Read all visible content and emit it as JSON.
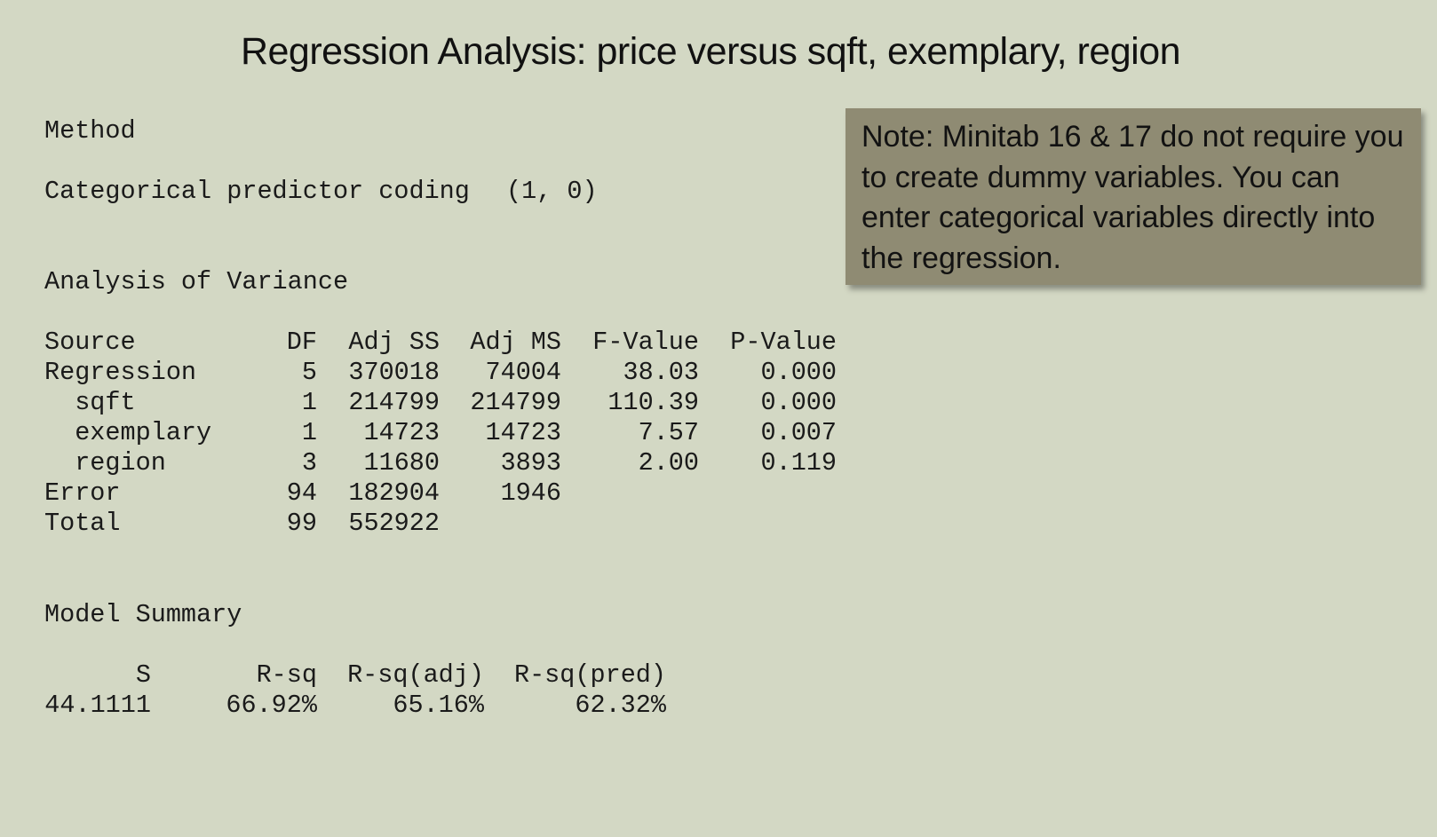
{
  "title": "Regression Analysis: price versus sqft, exemplary, region",
  "method": {
    "heading": "Method",
    "coding_label": "Categorical predictor coding",
    "coding_value": "(1, 0)"
  },
  "anova": {
    "heading": "Analysis of Variance",
    "headers": [
      "Source",
      "DF",
      "Adj SS",
      "Adj MS",
      "F-Value",
      "P-Value"
    ],
    "rows": [
      [
        "Regression",
        "5",
        "370018",
        "74004",
        "38.03",
        "0.000"
      ],
      [
        "  sqft",
        "1",
        "214799",
        "214799",
        "110.39",
        "0.000"
      ],
      [
        "  exemplary",
        "1",
        "14723",
        "14723",
        "7.57",
        "0.007"
      ],
      [
        "  region",
        "3",
        "11680",
        "3893",
        "2.00",
        "0.119"
      ],
      [
        "Error",
        "94",
        "182904",
        "1946",
        "",
        ""
      ],
      [
        "Total",
        "99",
        "552922",
        "",
        "",
        ""
      ]
    ]
  },
  "model_summary": {
    "heading": "Model Summary",
    "headers": [
      "S",
      "R-sq",
      "R-sq(adj)",
      "R-sq(pred)"
    ],
    "values": [
      "44.1111",
      "66.92%",
      "65.16%",
      "62.32%"
    ]
  },
  "note": {
    "text": "Note: Minitab 16 & 17 do not require you to create dummy variables. You can enter categorical variables directly into the regression."
  },
  "colors": {
    "background": "#d3d8c4",
    "note_background": "#8f8b73",
    "text": "#1a1a1a"
  }
}
